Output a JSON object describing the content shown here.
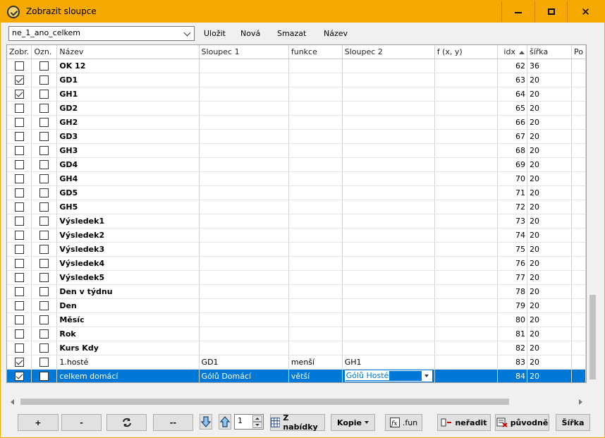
{
  "window": {
    "title": "Zobrazit sloupce"
  },
  "toolbar": {
    "profile_value": "ne_1_ano_celkem",
    "save_label": "Uložit",
    "new_label": "Nová",
    "delete_label": "Smazat",
    "name_label": "Název"
  },
  "columns": [
    "Zobr.",
    "Ozn.",
    "Název",
    "Sloupec 1",
    "funkce",
    "Sloupec 2",
    "f (x, y)",
    "idx",
    "šířka",
    "Po"
  ],
  "rows": [
    {
      "show": false,
      "mark": false,
      "name": "OK 12",
      "col1": "",
      "func": "",
      "col2": "",
      "fxy": "",
      "idx": "62",
      "width": "36",
      "bold": true
    },
    {
      "show": true,
      "mark": false,
      "name": "GD1",
      "col1": "",
      "func": "",
      "col2": "",
      "fxy": "",
      "idx": "63",
      "width": "20",
      "bold": true
    },
    {
      "show": true,
      "mark": false,
      "name": "GH1",
      "col1": "",
      "func": "",
      "col2": "",
      "fxy": "",
      "idx": "64",
      "width": "20",
      "bold": true
    },
    {
      "show": false,
      "mark": false,
      "name": "GD2",
      "col1": "",
      "func": "",
      "col2": "",
      "fxy": "",
      "idx": "65",
      "width": "20",
      "bold": true
    },
    {
      "show": false,
      "mark": false,
      "name": "GH2",
      "col1": "",
      "func": "",
      "col2": "",
      "fxy": "",
      "idx": "66",
      "width": "20",
      "bold": true
    },
    {
      "show": false,
      "mark": false,
      "name": "GD3",
      "col1": "",
      "func": "",
      "col2": "",
      "fxy": "",
      "idx": "67",
      "width": "20",
      "bold": true
    },
    {
      "show": false,
      "mark": false,
      "name": "GH3",
      "col1": "",
      "func": "",
      "col2": "",
      "fxy": "",
      "idx": "68",
      "width": "20",
      "bold": true
    },
    {
      "show": false,
      "mark": false,
      "name": "GD4",
      "col1": "",
      "func": "",
      "col2": "",
      "fxy": "",
      "idx": "69",
      "width": "20",
      "bold": true
    },
    {
      "show": false,
      "mark": false,
      "name": "GH4",
      "col1": "",
      "func": "",
      "col2": "",
      "fxy": "",
      "idx": "70",
      "width": "20",
      "bold": true
    },
    {
      "show": false,
      "mark": false,
      "name": "GD5",
      "col1": "",
      "func": "",
      "col2": "",
      "fxy": "",
      "idx": "71",
      "width": "20",
      "bold": true
    },
    {
      "show": false,
      "mark": false,
      "name": "GH5",
      "col1": "",
      "func": "",
      "col2": "",
      "fxy": "",
      "idx": "72",
      "width": "20",
      "bold": true
    },
    {
      "show": false,
      "mark": false,
      "name": "Výsledek1",
      "col1": "",
      "func": "",
      "col2": "",
      "fxy": "",
      "idx": "73",
      "width": "20",
      "bold": true
    },
    {
      "show": false,
      "mark": false,
      "name": "Výsledek2",
      "col1": "",
      "func": "",
      "col2": "",
      "fxy": "",
      "idx": "74",
      "width": "20",
      "bold": true
    },
    {
      "show": false,
      "mark": false,
      "name": "Výsledek3",
      "col1": "",
      "func": "",
      "col2": "",
      "fxy": "",
      "idx": "75",
      "width": "20",
      "bold": true
    },
    {
      "show": false,
      "mark": false,
      "name": "Výsledek4",
      "col1": "",
      "func": "",
      "col2": "",
      "fxy": "",
      "idx": "76",
      "width": "20",
      "bold": true
    },
    {
      "show": false,
      "mark": false,
      "name": "Výsledek5",
      "col1": "",
      "func": "",
      "col2": "",
      "fxy": "",
      "idx": "77",
      "width": "20",
      "bold": true
    },
    {
      "show": false,
      "mark": false,
      "name": "Den v týdnu",
      "col1": "",
      "func": "",
      "col2": "",
      "fxy": "",
      "idx": "78",
      "width": "20",
      "bold": true
    },
    {
      "show": false,
      "mark": false,
      "name": "Den",
      "col1": "",
      "func": "",
      "col2": "",
      "fxy": "",
      "idx": "79",
      "width": "20",
      "bold": true
    },
    {
      "show": false,
      "mark": false,
      "name": "Měsíc",
      "col1": "",
      "func": "",
      "col2": "",
      "fxy": "",
      "idx": "80",
      "width": "20",
      "bold": true
    },
    {
      "show": false,
      "mark": false,
      "name": "Rok",
      "col1": "",
      "func": "",
      "col2": "",
      "fxy": "",
      "idx": "81",
      "width": "20",
      "bold": true
    },
    {
      "show": false,
      "mark": false,
      "name": "Kurs Kdy",
      "col1": "",
      "func": "",
      "col2": "",
      "fxy": "",
      "idx": "82",
      "width": "20",
      "bold": true
    },
    {
      "show": true,
      "mark": false,
      "name": "1.hosté",
      "col1": "GD1",
      "func": "menší",
      "col2": "GH1",
      "fxy": "",
      "idx": "83",
      "width": "20",
      "bold": false
    },
    {
      "show": true,
      "mark": false,
      "name": "celkem domácí",
      "col1": "Gólů Domácí",
      "func": "větší",
      "col2": "Gólů Hosté",
      "fxy": "",
      "idx": "84",
      "width": "20",
      "bold": false,
      "selected": true
    }
  ],
  "bottom": {
    "plus": "+",
    "minus": "-",
    "dashes": "--",
    "spin_value": "1",
    "from_menu": "Z nabídky",
    "copy": "Kopie",
    "fun": ".fun",
    "unsort": "neřadit",
    "original": "původně",
    "width": "Šířka"
  },
  "colors": {
    "titlebar": "#f5a800",
    "selection": "#0078d7"
  }
}
